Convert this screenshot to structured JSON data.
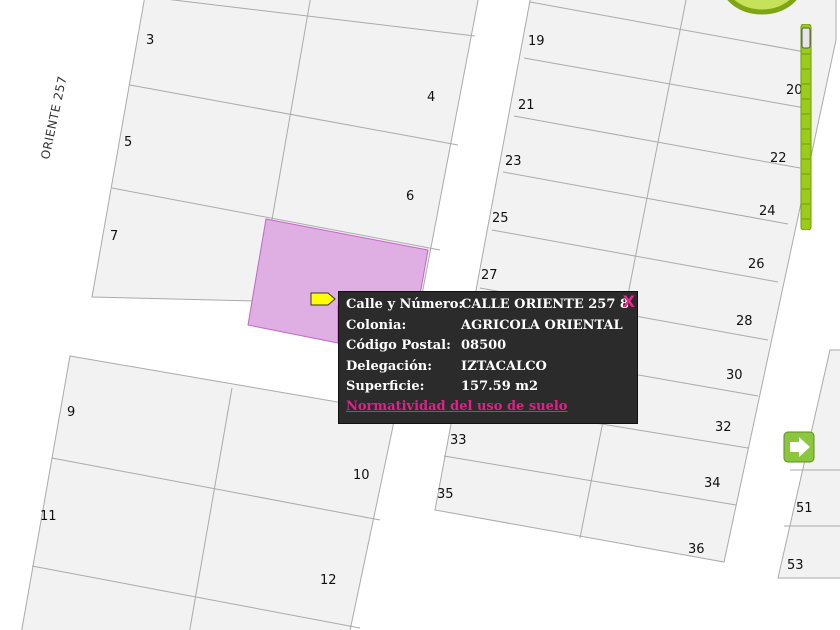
{
  "map": {
    "street_label": "ORIENTE 257",
    "lot_numbers": [
      "3",
      "4",
      "5",
      "6",
      "7",
      "9",
      "10",
      "11",
      "12",
      "19",
      "20",
      "21",
      "22",
      "23",
      "24",
      "25",
      "26",
      "27",
      "28",
      "30",
      "32",
      "33",
      "34",
      "35",
      "36",
      "51",
      "53"
    ]
  },
  "popup": {
    "rows": [
      {
        "label": "Calle y Número:",
        "value": "CALLE ORIENTE 257 8"
      },
      {
        "label": "Colonia:",
        "value": "AGRICOLA ORIENTAL"
      },
      {
        "label": "Código Postal:",
        "value": "08500"
      },
      {
        "label": "Delegación:",
        "value": "IZTACALCO"
      },
      {
        "label": "Superficie:",
        "value": "157.59 m2"
      }
    ],
    "link": "Normatividad del uso de suelo",
    "close": "X"
  },
  "colors": {
    "selected_fill": "#dfaee3",
    "selected_stroke": "#c266c8",
    "popup_bg": "#2b2b2b",
    "link": "#e0218a",
    "controls": "#9ccc1a"
  },
  "icons": {
    "marker": "yellow-arrow-marker",
    "zoom": "zoom-slider",
    "pan": "pan-ring",
    "next": "green-arrow-icon"
  }
}
